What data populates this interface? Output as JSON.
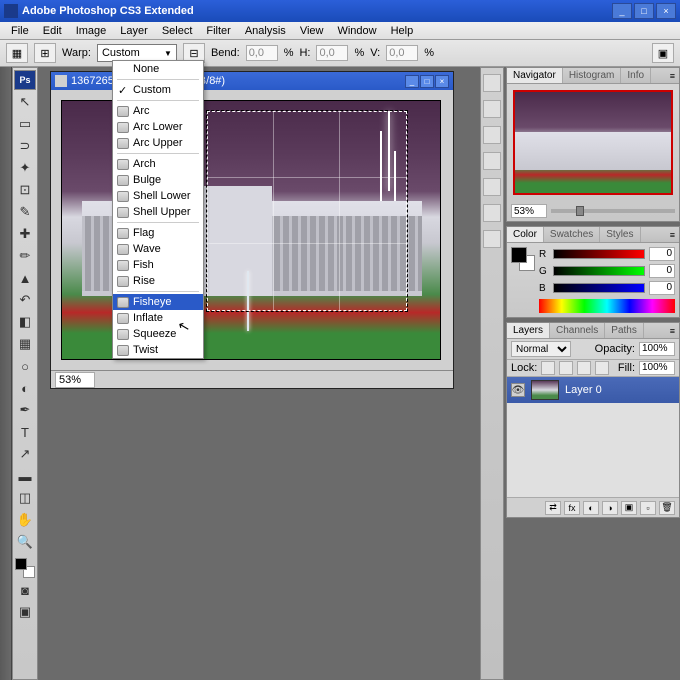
{
  "app": {
    "title": "Adobe Photoshop CS3 Extended"
  },
  "menu": [
    "File",
    "Edit",
    "Image",
    "Layer",
    "Select",
    "Filter",
    "Analysis",
    "View",
    "Window",
    "Help"
  ],
  "options": {
    "warp_label": "Warp:",
    "warp_value": "Custom",
    "bend_label": "Bend:",
    "bend_value": "0,0",
    "bend_unit": "%",
    "h_label": "H:",
    "h_value": "0,0",
    "h_unit": "%",
    "v_label": "V:",
    "v_value": "0,0",
    "v_unit": "%"
  },
  "dropdown": {
    "items": [
      {
        "label": "None"
      },
      {
        "label": "Custom",
        "checked": true
      },
      {
        "label": "Arc",
        "icon": true
      },
      {
        "label": "Arc Lower",
        "icon": true
      },
      {
        "label": "Arc Upper",
        "icon": true
      },
      {
        "label": "Arch",
        "icon": true
      },
      {
        "label": "Bulge",
        "icon": true
      },
      {
        "label": "Shell Lower",
        "icon": true
      },
      {
        "label": "Shell Upper",
        "icon": true
      },
      {
        "label": "Flag",
        "icon": true
      },
      {
        "label": "Wave",
        "icon": true
      },
      {
        "label": "Fish",
        "icon": true
      },
      {
        "label": "Rise",
        "icon": true
      },
      {
        "label": "Fisheye",
        "icon": true,
        "selected": true
      },
      {
        "label": "Inflate",
        "icon": true
      },
      {
        "label": "Squeeze",
        "icon": true
      },
      {
        "label": "Twist",
        "icon": true
      }
    ]
  },
  "document": {
    "title": "1367265...% (Layer 0, RGB/8#)",
    "zoom": "53%",
    "status": ""
  },
  "navigator": {
    "tabs": [
      "Navigator",
      "Histogram",
      "Info"
    ],
    "zoom": "53%"
  },
  "color": {
    "tabs": [
      "Color",
      "Swatches",
      "Styles"
    ],
    "r": "0",
    "g": "0",
    "b": "0",
    "labels": {
      "r": "R",
      "g": "G",
      "b": "B"
    }
  },
  "layers": {
    "tabs": [
      "Layers",
      "Channels",
      "Paths"
    ],
    "blend": "Normal",
    "opacity_label": "Opacity:",
    "opacity": "100%",
    "lock_label": "Lock:",
    "fill_label": "Fill:",
    "fill": "100%",
    "items": [
      {
        "name": "Layer 0"
      }
    ]
  }
}
